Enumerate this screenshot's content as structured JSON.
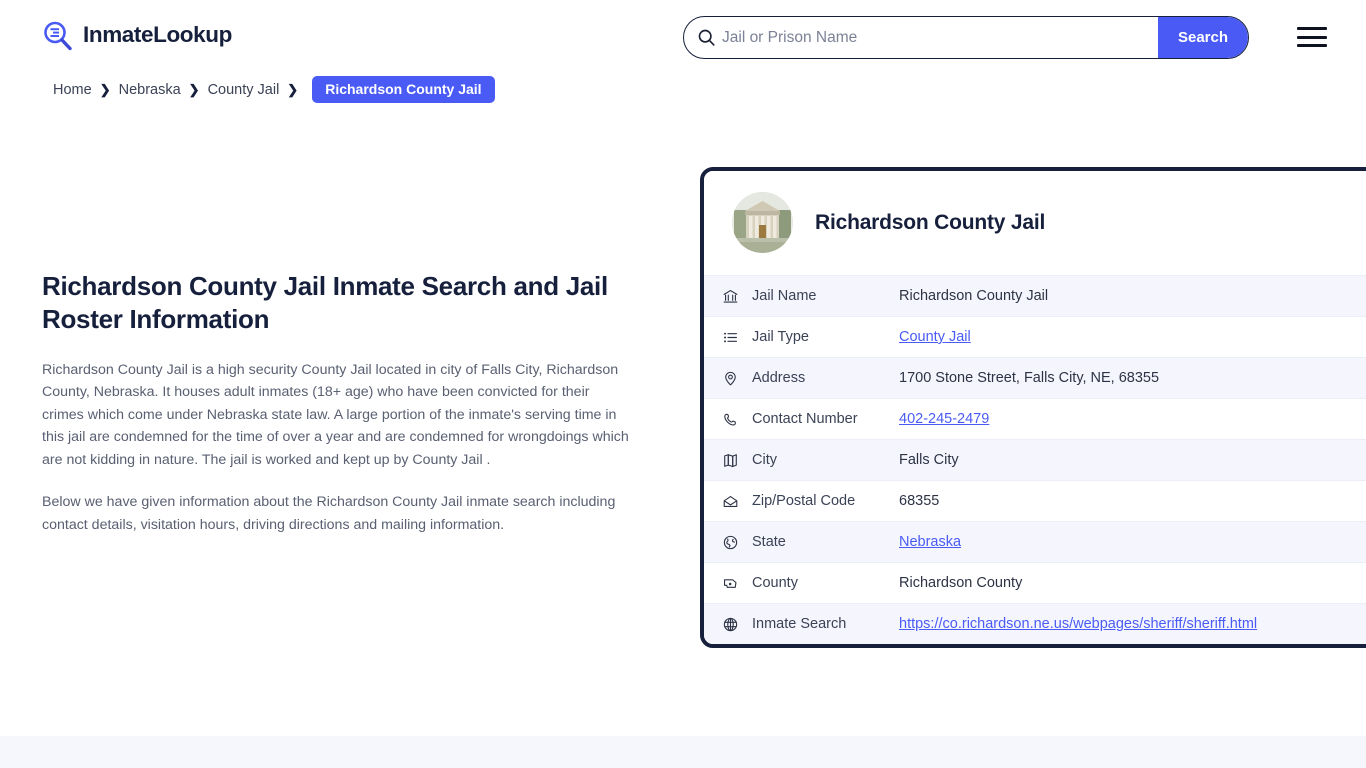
{
  "site": {
    "brand_name": "InmateLookup",
    "logo_icon": "magnifier-list-icon",
    "menu_icon": "hamburger-menu-icon"
  },
  "search": {
    "placeholder": "Jail or Prison Name",
    "value": "",
    "button_label": "Search",
    "icon": "search-icon"
  },
  "breadcrumb": {
    "items": [
      {
        "label": "Home",
        "current": false
      },
      {
        "label": "Nebraska",
        "current": false
      },
      {
        "label": "County Jail",
        "current": false
      }
    ],
    "separator": "❯",
    "current": "Richardson County Jail"
  },
  "main": {
    "title": "Richardson County Jail Inmate Search and Jail Roster Information",
    "paragraphs": [
      "Richardson County Jail is a high security County Jail located in city of Falls City, Richardson County, Nebraska. It houses adult inmates (18+ age) who have been convicted for their crimes which come under Nebraska state law. A large portion of the inmate's serving time in this jail are condemned for the time of over a year and are condemned for wrongdoings which are not kidding in nature. The jail is worked and kept up by County Jail .",
      "Below we have given information about the Richardson County Jail inmate search including contact details, visitation hours, driving directions and mailing information."
    ]
  },
  "card": {
    "title": "Richardson County Jail",
    "avatar_icon": "courthouse-photo",
    "rows": [
      {
        "icon": "bank-icon",
        "label": "Jail Name",
        "value": "Richardson County Jail",
        "link": false
      },
      {
        "icon": "list-icon",
        "label": "Jail Type",
        "value": "County Jail",
        "link": true
      },
      {
        "icon": "map-pin-icon",
        "label": "Address",
        "value": "1700 Stone Street, Falls City, NE, 68355",
        "link": false
      },
      {
        "icon": "phone-icon",
        "label": "Contact Number",
        "value": "402-245-2479",
        "link": true
      },
      {
        "icon": "map-icon",
        "label": "City",
        "value": "Falls City",
        "link": false
      },
      {
        "icon": "envelope-icon",
        "label": "Zip/Postal Code",
        "value": "68355",
        "link": false
      },
      {
        "icon": "globe-pin-icon",
        "label": "State",
        "value": "Nebraska",
        "link": true
      },
      {
        "icon": "county-map-icon",
        "label": "County",
        "value": "Richardson County",
        "link": false
      },
      {
        "icon": "web-globe-icon",
        "label": "Inmate Search",
        "value": "https://co.richardson.ne.us/webpages/sheriff/sheriff.html",
        "link": true
      }
    ]
  },
  "colors": {
    "accent": "#4a5bf5",
    "ink": "#16203c",
    "row_tint": "#f5f6fd",
    "band": "#f6f6fd"
  }
}
